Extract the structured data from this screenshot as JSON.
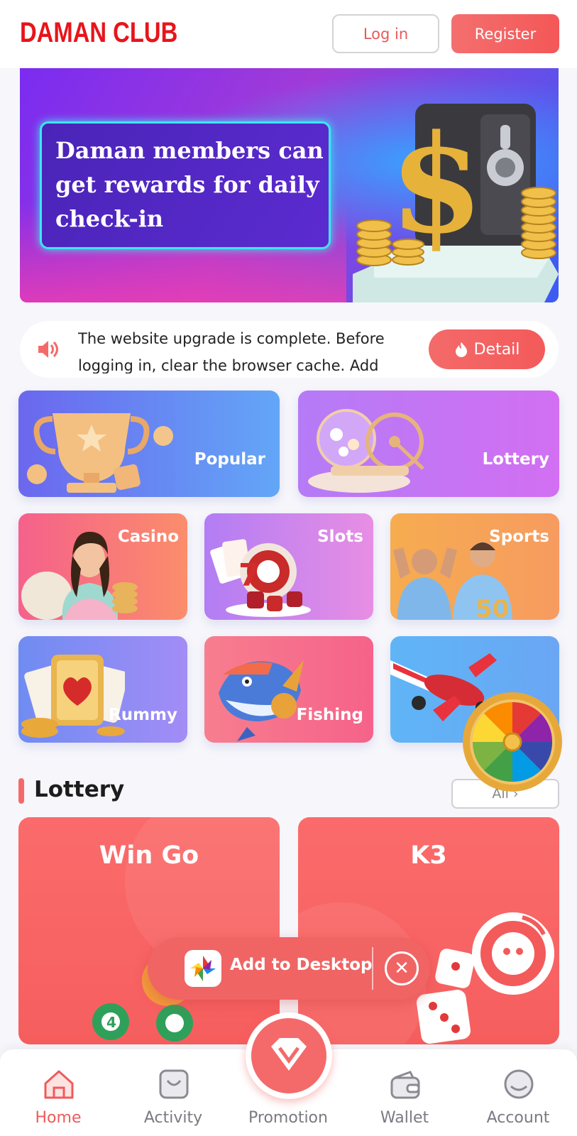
{
  "header": {
    "logo": "DAMAN CLUB",
    "login_label": "Log in",
    "register_label": "Register"
  },
  "banner": {
    "text": "Daman members can get rewards for daily check-in"
  },
  "notice": {
    "text": "The website upgrade is complete. Before logging in, clear the browser cache. Add",
    "detail_label": "Detail",
    "icon": "speaker-icon"
  },
  "categories": {
    "popular": "Popular",
    "lottery": "Lottery",
    "casino": "Casino",
    "slots": "Slots",
    "sports": "Sports",
    "rummy": "Rummy",
    "fishing": "Fishing"
  },
  "lottery_section": {
    "title": "Lottery",
    "all_label": "All",
    "games": [
      "Win Go",
      "K3"
    ]
  },
  "floating": {
    "add_desktop_label": "Add to Desktop"
  },
  "nav": {
    "home": "Home",
    "activity": "Activity",
    "promotion": "Promotion",
    "wallet": "Wallet",
    "account": "Account"
  },
  "colors": {
    "brand_red": "#e8141b",
    "accent": "#f46a6a",
    "active_nav": "#ef5b5b"
  }
}
